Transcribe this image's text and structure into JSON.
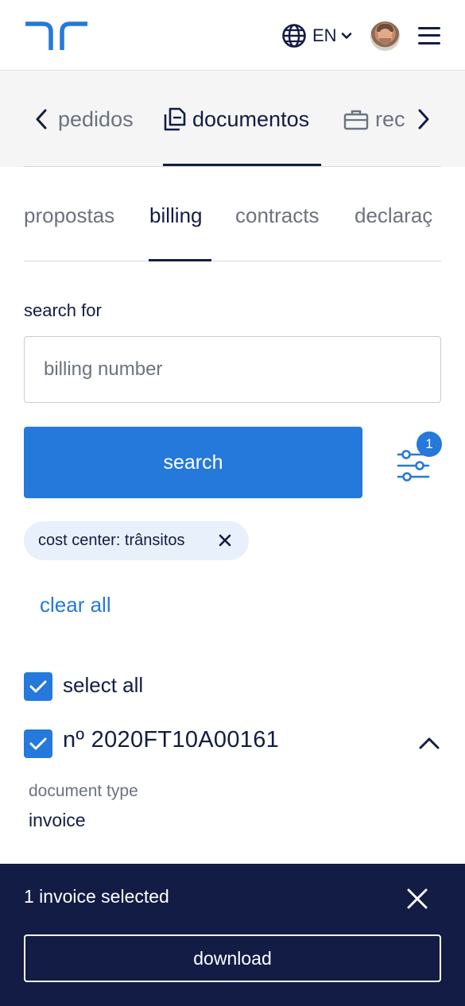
{
  "header": {
    "logo_icon": "brand-logo-icon",
    "language": "EN",
    "globe_icon": "globe-icon",
    "avatar_icon": "user-avatar",
    "menu_icon": "hamburger-menu-icon"
  },
  "primary_tabs": {
    "prev_icon": "chevron-left-icon",
    "next_icon": "chevron-right-icon",
    "items": [
      {
        "label": "pedidos",
        "icon": ""
      },
      {
        "label": "documentos",
        "icon": "document-icon",
        "active": true
      },
      {
        "label": "rec",
        "icon": "briefcase-icon"
      }
    ]
  },
  "secondary_tabs": {
    "items": [
      {
        "label": "propostas"
      },
      {
        "label": "billing",
        "active": true
      },
      {
        "label": "contracts"
      },
      {
        "label": "declaraç"
      }
    ]
  },
  "search": {
    "label": "search for",
    "placeholder": "billing number",
    "value": "",
    "button_label": "search",
    "filter_count": "1",
    "filter_icon": "sliders-icon"
  },
  "filters": {
    "chips": [
      {
        "label": "cost center: trânsitos",
        "remove_icon": "close-icon"
      }
    ],
    "clear_all_label": "clear all"
  },
  "list": {
    "select_all_label": "select all",
    "select_all_checked": true,
    "items": [
      {
        "title": "nº 2020FT10A00161",
        "checked": true,
        "expanded": true,
        "fields": [
          {
            "label": "document type",
            "value": "invoice"
          }
        ]
      }
    ]
  },
  "footer": {
    "selection_text": "1 invoice selected",
    "download_label": "download",
    "close_icon": "close-icon"
  },
  "colors": {
    "primary": "#2479da",
    "navy": "#121c45",
    "text": "#131c44",
    "muted": "#6b7280",
    "chip_bg": "#e8f0fb",
    "tab_bar_bg": "#f5f5f5"
  }
}
